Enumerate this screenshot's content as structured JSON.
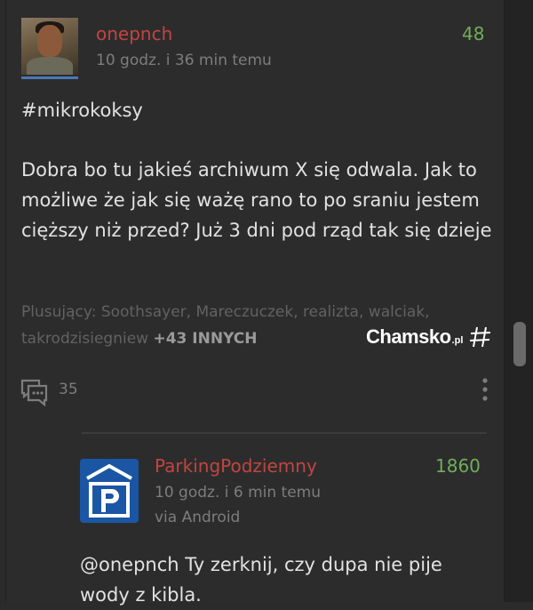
{
  "post": {
    "username": "onepnch",
    "time": "10 godz. i 36 min temu",
    "score": "48",
    "tag": "#mikrokoksy",
    "body": "Dobra bo tu jakieś archiwum X się odwala. Jak to możliwe że jak się ważę rano to po sraniu jestem cięższy niż przed? Już 3 dni pod rząd tak się dzieje",
    "voters_label": "Plusujący: Soothsayer, Mareczuczek, realizta, walciak, takrodzisiegniew",
    "voters_more": "+43 INNYCH",
    "comments_count": "35"
  },
  "watermark": {
    "text": "Chamsko",
    "suffix": ".pl"
  },
  "reply": {
    "username": "ParkingPodziemny",
    "time": "10 godz. i 6 min temu",
    "via": "via Android",
    "score": "1860",
    "text": "@onepnch Ty zerknij, czy dupa nie pije wody z kibla."
  },
  "colors": {
    "username": "#c2453f",
    "score": "#6fae58",
    "muted": "#7d7d7d",
    "background": "#2c2c2d"
  },
  "icons": [
    "comment-icon",
    "more-options-icon",
    "parking-avatar",
    "hash-icon"
  ]
}
